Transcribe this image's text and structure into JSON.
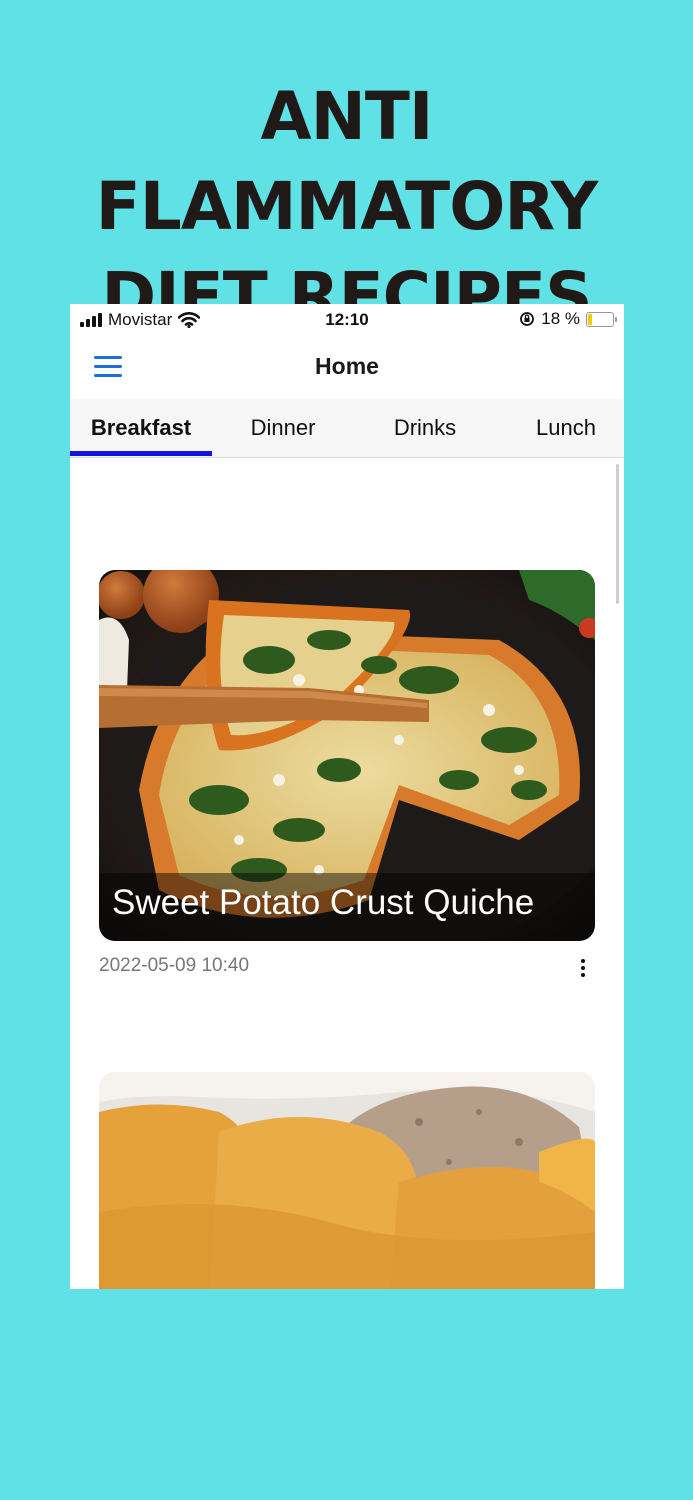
{
  "banner": {
    "line1": "ANTI FLAMMATORY",
    "line2": "DIET RECIPES"
  },
  "status_bar": {
    "carrier": "Movistar",
    "time": "12:10",
    "battery": "18 %",
    "battery_level": 0.18
  },
  "header": {
    "title": "Home",
    "menu_icon": "hamburger-menu-icon"
  },
  "tabs": [
    {
      "label": "Breakfast",
      "active": true
    },
    {
      "label": "Dinner",
      "active": false
    },
    {
      "label": "Drinks",
      "active": false
    },
    {
      "label": "Lunch",
      "active": false
    }
  ],
  "recipes": [
    {
      "title": "Sweet Potato Crust Quiche",
      "date": "2022-05-09 10:40",
      "image": "quiche-photo"
    },
    {
      "title": "",
      "date": "",
      "image": "sweet-potato-dish-photo"
    }
  ],
  "colors": {
    "background": "#5fe1e6",
    "accent": "#1a6fd8",
    "tab_indicator": "#1414e0"
  }
}
